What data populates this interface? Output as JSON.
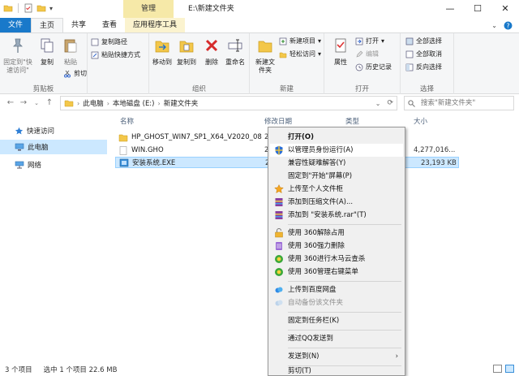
{
  "window": {
    "title": "E:\\新建文件夹",
    "context_tab": "管理",
    "controls": [
      "—",
      "☐",
      "✕"
    ]
  },
  "ribbon": {
    "tabs": [
      "文件",
      "主页",
      "共享",
      "查看",
      "应用程序工具"
    ],
    "clipboard": {
      "pin_label": "固定到\"快速访问\"",
      "copy_label": "复制",
      "paste_label": "粘贴",
      "cut_label": "剪切",
      "copy_path_label": "复制路径",
      "paste_shortcut_label": "粘贴快捷方式",
      "group_label": "剪贴板"
    },
    "organize": {
      "move_to_label": "移动到",
      "copy_to_label": "复制到",
      "delete_label": "删除",
      "rename_label": "重命名",
      "group_label": "组织"
    },
    "new": {
      "new_folder_label": "新建文件夹",
      "new_item_label": "新建项目",
      "easy_access_label": "轻松访问",
      "group_label": "新建"
    },
    "open": {
      "properties_label": "属性",
      "open_label": "打开",
      "edit_label": "编辑",
      "history_label": "历史记录",
      "group_label": "打开"
    },
    "select": {
      "select_all_label": "全部选择",
      "select_none_label": "全部取消",
      "invert_label": "反向选择",
      "group_label": "选择"
    }
  },
  "address": {
    "crumbs": [
      "此电脑",
      "本地磁盘 (E:)",
      "新建文件夹"
    ],
    "search_placeholder": "搜索\"新建文件夹\""
  },
  "nav": {
    "items": [
      "快速访问",
      "此电脑",
      "网络"
    ]
  },
  "files": {
    "columns": [
      "名称",
      "修改日期",
      "类型",
      "大小"
    ],
    "rows": [
      {
        "name": "HP_GHOST_WIN7_SP1_X64_V2020_08",
        "date": "2",
        "type": "",
        "size": ""
      },
      {
        "name": "WIN.GHO",
        "date": "2",
        "type": "",
        "size": "4,277,016..."
      },
      {
        "name": "安装系统.EXE",
        "date": "2",
        "type": "",
        "size": "23,193 KB"
      }
    ]
  },
  "status": {
    "count": "3 个项目",
    "selection": "选中 1 个项目  22.6 MB"
  },
  "context_menu": {
    "items": [
      {
        "label": "打开(O)",
        "bold": true
      },
      {
        "label": "以管理员身份运行(A)",
        "highlight": true
      },
      {
        "label": "兼容性疑难解答(Y)"
      },
      {
        "label": "固定到\"开始\"屏幕(P)"
      },
      {
        "label": "上传至个人文件柜"
      },
      {
        "label": "添加到压缩文件(A)..."
      },
      {
        "label": "添加到 \"安装系统.rar\"(T)"
      },
      {
        "label": "使用 360解除占用"
      },
      {
        "label": "使用 360强力删除"
      },
      {
        "label": "使用 360进行木马云查杀"
      },
      {
        "label": "使用 360管理右键菜单"
      },
      {
        "label": "上传到百度网盘"
      },
      {
        "label": "自动备份该文件夹",
        "disabled": true
      },
      {
        "label": "固定到任务栏(K)"
      },
      {
        "label": "通过QQ发送到"
      },
      {
        "label": "发送到(N)",
        "submenu": true
      },
      {
        "label": "剪切(T)"
      }
    ]
  },
  "colors": {
    "file_tab": "#1979ca",
    "selection": "#cce8ff",
    "context_tab": "#f6e9a8"
  }
}
